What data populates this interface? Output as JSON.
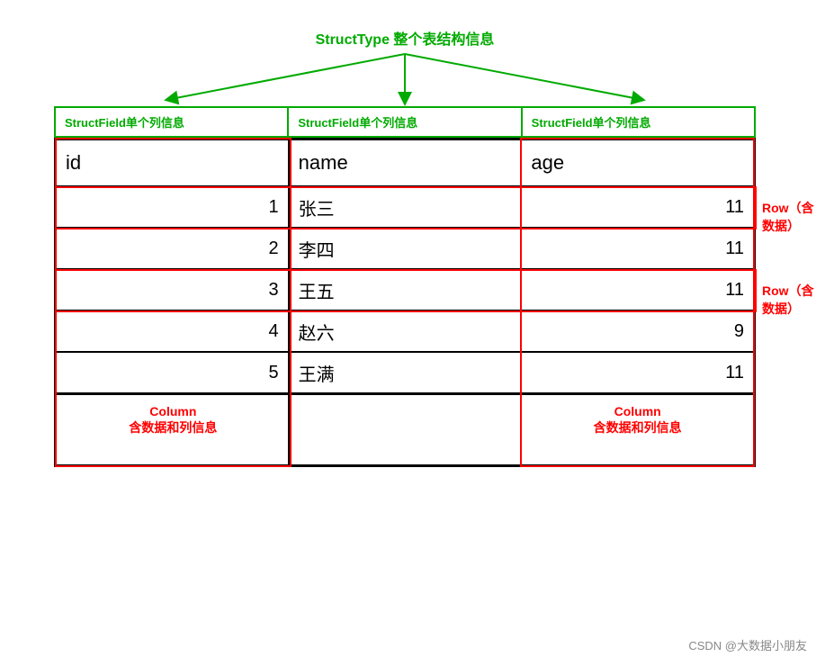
{
  "structType": {
    "label": "StructType 整个表结构信息"
  },
  "headers": [
    {
      "label": "StructField单个列信息"
    },
    {
      "label": "StructField单个列信息"
    },
    {
      "label": "StructField单个列信息"
    }
  ],
  "columns": [
    {
      "name": "id"
    },
    {
      "name": "name"
    },
    {
      "name": "age"
    }
  ],
  "rows": [
    {
      "id": "1",
      "name": "张三",
      "age": "11"
    },
    {
      "id": "2",
      "name": "李四",
      "age": "11"
    },
    {
      "id": "3",
      "name": "王五",
      "age": "11"
    },
    {
      "id": "4",
      "name": "赵六",
      "age": "9"
    },
    {
      "id": "5",
      "name": "王满",
      "age": "11"
    }
  ],
  "rowLabels": [
    {
      "text": "Row（含数据）"
    },
    {
      "text": "Row（含数据）"
    }
  ],
  "columnLabels": [
    {
      "title": "Column",
      "subtitle": "含数据和列信息"
    },
    {
      "title": "Column",
      "subtitle": "含数据和列信息"
    }
  ],
  "watermark": "CSDN @大数据小朋友"
}
